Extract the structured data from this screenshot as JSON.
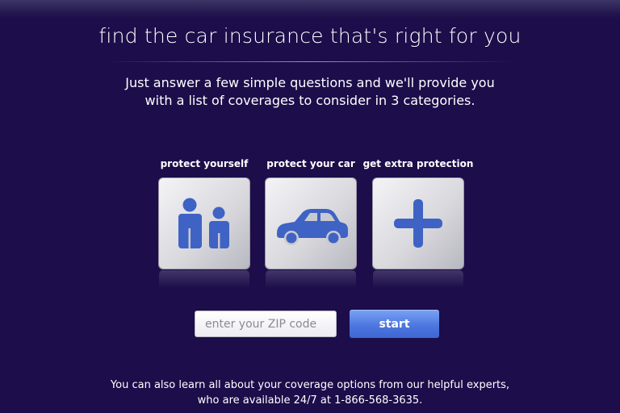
{
  "header": {
    "headline": "find the car insurance that's right for you",
    "intro_line1": "Just answer a few simple questions and we'll provide you",
    "intro_line2": "with a list of coverages to consider in 3 categories."
  },
  "categories": [
    {
      "label": "protect yourself",
      "icon": "people-icon"
    },
    {
      "label": "protect your car",
      "icon": "car-icon"
    },
    {
      "label": "get extra protection",
      "icon": "plus-icon"
    }
  ],
  "form": {
    "zip_placeholder": "enter your ZIP code",
    "zip_value": "",
    "start_label": "start"
  },
  "footer": {
    "line1": "You can also learn all about your coverage options from our helpful experts,",
    "line2": "who are available 24/7 at 1-866-568-3635."
  },
  "colors": {
    "background": "#1d0d4a",
    "icon_blue": "#3f63c4",
    "button_blue": "#4e78e0"
  }
}
